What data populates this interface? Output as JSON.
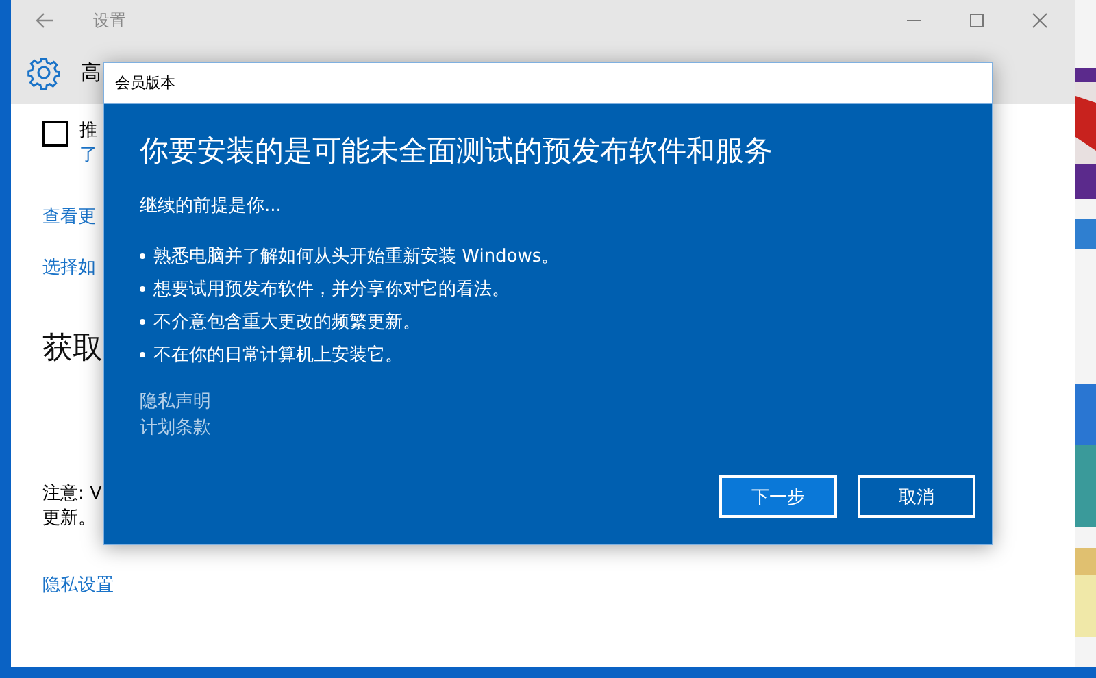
{
  "window": {
    "title": "设置",
    "header": "高"
  },
  "content": {
    "checkbox": {
      "label": "推",
      "checked": false
    },
    "link_under_checkbox": "了",
    "links": [
      "查看更",
      "选择如"
    ],
    "heading": "获取",
    "note_lines": [
      "注意: V",
      "更新。"
    ],
    "privacy_link": "隐私设置"
  },
  "dialog": {
    "title": "会员版本",
    "heading": "你要安装的是可能未全面测试的预发布软件和服务",
    "intro": "继续的前提是你...",
    "bullets": [
      "熟悉电脑并了解如何从头开始重新安装 Windows。",
      "想要试用预发布软件，并分享你对它的看法。",
      "不介意包含重大更改的频繁更新。",
      "不在你的日常计算机上安装它。"
    ],
    "links": [
      "隐私声明",
      "计划条款"
    ],
    "buttons": [
      {
        "label": "下一步",
        "kind": "primary"
      },
      {
        "label": "取消",
        "kind": "secondary"
      }
    ]
  }
}
